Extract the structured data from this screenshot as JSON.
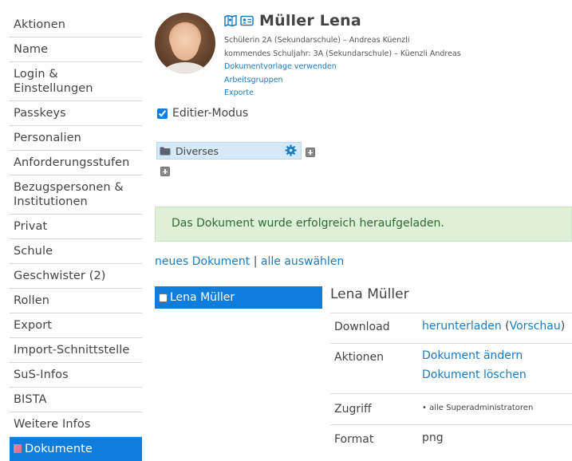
{
  "sidebar": {
    "items": [
      {
        "label": "Aktionen"
      },
      {
        "label": "Name"
      },
      {
        "label": "Login & Einstellungen"
      },
      {
        "label": "Passkeys"
      },
      {
        "label": "Personalien"
      },
      {
        "label": "Anforderungsstufen"
      },
      {
        "label": "Bezugspersonen & Institutionen"
      },
      {
        "label": "Privat"
      },
      {
        "label": "Schule"
      },
      {
        "label": "Geschwister (2)"
      },
      {
        "label": "Rollen"
      },
      {
        "label": "Export"
      },
      {
        "label": "Import-Schnittstelle"
      },
      {
        "label": "SuS-Infos"
      },
      {
        "label": "BISTA"
      },
      {
        "label": "Weitere Infos"
      },
      {
        "label": "Dokumente",
        "active": true
      }
    ]
  },
  "profile": {
    "name": "Müller Lena",
    "line1": "Schülerin 2A (Sekundarschule) – Andreas Küenzli",
    "line2": "kommendes Schuljahr: 3A (Sekundarschule) – Küenzli Andreas",
    "links": [
      "Dokumentvorlage verwenden",
      "Arbeitsgruppen",
      "Exporte"
    ]
  },
  "edit_mode": {
    "label": "Editier-Modus",
    "checked": true
  },
  "folder": {
    "label": "Diverses"
  },
  "alert": {
    "text": "Das Dokument wurde erfolgreich heraufgeladen."
  },
  "actions": {
    "new_doc": "neues Dokument",
    "separator": "|",
    "select_all": "alle auswählen"
  },
  "documents": [
    {
      "label": "Lena Müller"
    }
  ],
  "detail": {
    "title": "Lena Müller",
    "download_label": "Download",
    "download_link": "herunterladen",
    "preview_open": "(",
    "preview_link": "Vorschau",
    "preview_close": ")",
    "actions_label": "Aktionen",
    "edit_link": "Dokument ändern",
    "delete_link": "Dokument löschen",
    "access_label": "Zugriff",
    "access_value": "• alle Superadministratoren",
    "format_label": "Format",
    "format_value": "png"
  },
  "colors": {
    "accent": "#0e7ddc",
    "link": "#1a7bc2",
    "alert_bg": "#dff0d8"
  }
}
